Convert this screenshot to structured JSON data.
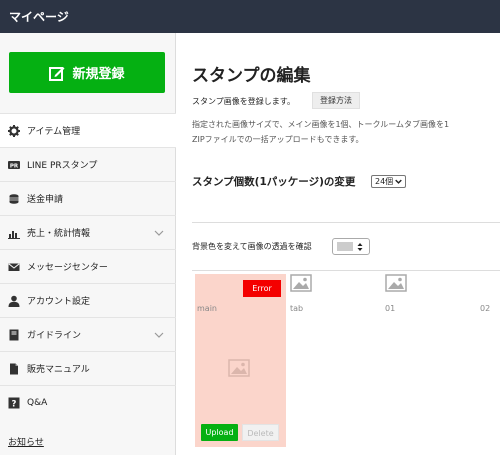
{
  "header": {
    "title": "マイページ"
  },
  "sidebar": {
    "new_button": "新規登録",
    "items": [
      {
        "label": "アイテム管理",
        "icon": "gear-icon",
        "chevron": false
      },
      {
        "label": "LINE PRスタンプ",
        "icon": "pr-icon",
        "chevron": false
      },
      {
        "label": "送金申請",
        "icon": "coins-icon",
        "chevron": false
      },
      {
        "label": "売上・統計情報",
        "icon": "bar-chart-icon",
        "chevron": true
      },
      {
        "label": "メッセージセンター",
        "icon": "envelope-icon",
        "chevron": false
      },
      {
        "label": "アカウント設定",
        "icon": "user-icon",
        "chevron": false
      },
      {
        "label": "ガイドライン",
        "icon": "book-icon",
        "chevron": true
      },
      {
        "label": "販売マニュアル",
        "icon": "document-icon",
        "chevron": false
      },
      {
        "label": "Q&A",
        "icon": "question-icon",
        "chevron": false
      }
    ],
    "notice_link": "お知らせ"
  },
  "main": {
    "title": "スタンプの編集",
    "register_desc": "スタンプ画像を登録します。",
    "howto_button": "登録方法",
    "desc_line1": "指定された画像サイズで、メイン画像を1個、トークルームタブ画像を1",
    "desc_line2": "ZIPファイルでの一括アップロードもできます。",
    "count_label": "スタンプ個数(1パッケージ)の変更",
    "count_value": "24個",
    "bg_label": "背景色を変えて画像の透過を確認",
    "slots": [
      {
        "label": "main",
        "error": "Error",
        "upload": "Upload",
        "delete": "Delete"
      },
      {
        "label": "tab"
      },
      {
        "label": "01"
      },
      {
        "label": "02"
      }
    ]
  },
  "colors": {
    "primary": "#05b012",
    "error": "#f40000",
    "topbar": "#2c3444",
    "error_bg": "#fbd5cb"
  }
}
